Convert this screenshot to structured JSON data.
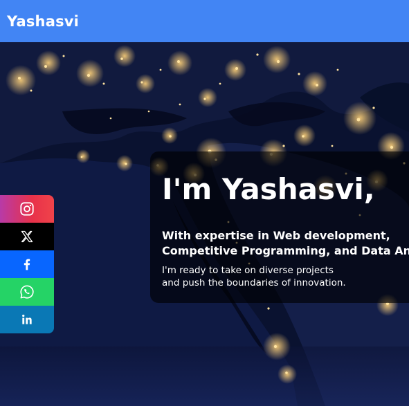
{
  "navbar": {
    "brand": "Yashasvi",
    "brand_color": "#ffffff",
    "background": "#4285f4"
  },
  "hero": {
    "background_image": "night-earth-satellite",
    "heading": "I'm Yashasvi,",
    "lead_line1": "With expertise in Web development,",
    "lead_line2": "Competitive Programming, and Data Analysis,",
    "sub_line1": "I'm ready to take on diverse projects",
    "sub_line2": "and push the boundaries of innovation."
  },
  "social": [
    {
      "name": "instagram",
      "icon": "instagram-icon",
      "color": "#e8324a"
    },
    {
      "name": "x",
      "icon": "x-icon",
      "color": "#000000"
    },
    {
      "name": "facebook",
      "icon": "facebook-icon",
      "color": "#0866ff"
    },
    {
      "name": "whatsapp",
      "icon": "whatsapp-icon",
      "color": "#25d366"
    },
    {
      "name": "linkedin",
      "icon": "linkedin-icon",
      "color": "#0a78b5"
    }
  ]
}
